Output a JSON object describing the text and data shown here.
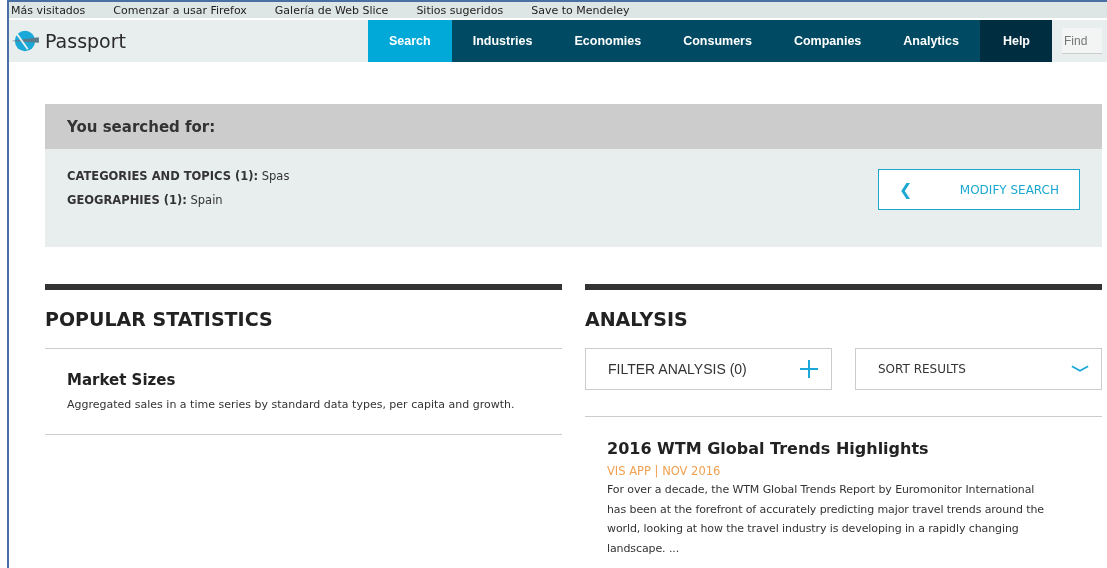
{
  "bookmarks": [
    "Más visitados",
    "Comenzar a usar Firefox",
    "Galería de Web Slice",
    "Sitios sugeridos",
    "Save to Mendeley"
  ],
  "brand": "Passport",
  "nav": [
    {
      "label": "Search",
      "selected": true,
      "kind": "main"
    },
    {
      "label": "Industries",
      "selected": false,
      "kind": "main"
    },
    {
      "label": "Economies",
      "selected": false,
      "kind": "main"
    },
    {
      "label": "Consumers",
      "selected": false,
      "kind": "main"
    },
    {
      "label": "Companies",
      "selected": false,
      "kind": "main"
    },
    {
      "label": "Analytics",
      "selected": false,
      "kind": "main"
    },
    {
      "label": "Help",
      "selected": false,
      "kind": "help"
    }
  ],
  "find": {
    "placeholder": "Find"
  },
  "search_summary": {
    "title": "You searched for:",
    "criteria": [
      {
        "label": "CATEGORIES AND TOPICS (1):",
        "value": "Spas"
      },
      {
        "label": "GEOGRAPHIES (1):",
        "value": "Spain"
      }
    ],
    "button": {
      "icon": "❮",
      "label": "MODIFY SEARCH"
    }
  },
  "popular_statistics": {
    "title": "POPULAR STATISTICS",
    "items": [
      {
        "title": "Market Sizes",
        "description": "Aggregated sales in a time series by standard data types, per capita and growth."
      }
    ]
  },
  "analysis": {
    "title": "ANALYSIS",
    "filter": "FILTER ANALYSIS (0)",
    "sort": "SORT RESULTS",
    "results": [
      {
        "title": "2016 WTM Global Trends Highlights",
        "meta": "VIS APP | NOV 2016",
        "summary": "For over a decade, the WTM Global Trends Report by Euromonitor International has been at the forefront of accurately predicting major travel trends around the world, looking at how the travel industry is developing in a rapidly changing landscape. ..."
      }
    ]
  }
}
